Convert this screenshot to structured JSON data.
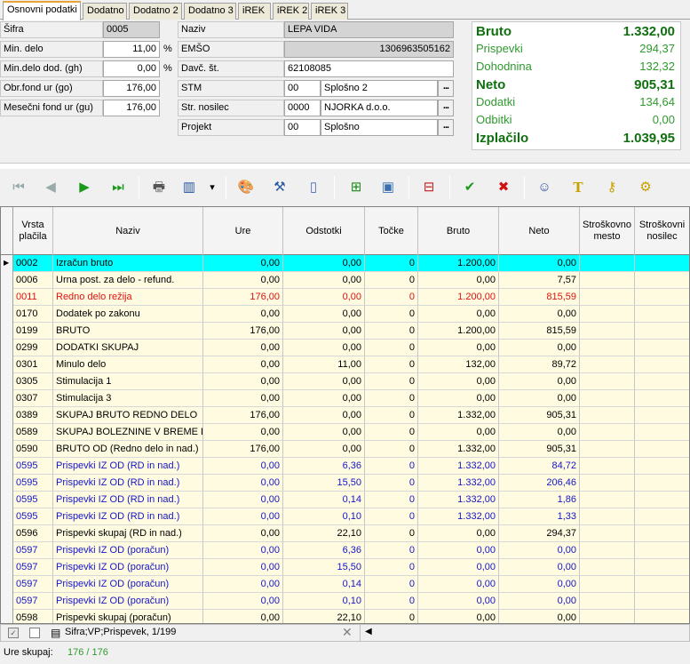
{
  "tabs": [
    "Osnovni podatki",
    "Dodatno",
    "Dodatno 2",
    "Dodatno 3",
    "iREK",
    "iREK 2",
    "iREK 3"
  ],
  "form": {
    "sifra_label": "Šifra",
    "sifra_value": "0005",
    "min_delo_label": "Min. delo",
    "min_delo_value": "11,00",
    "min_delo_dod_label": "Min.delo dod. (gh)",
    "min_delo_dod_value": "0,00",
    "obr_fond_label": "Obr.fond ur (go)",
    "obr_fond_value": "176,00",
    "mes_fond_label": "Mesečni fond ur (gu)",
    "mes_fond_value": "176,00",
    "percent": "%",
    "naziv_label": "Naziv",
    "naziv_value": "LEPA VIDA",
    "emso_label": "EMŠO",
    "emso_value": "1306963505162",
    "davc_label": "Davč. št.",
    "davc_value": "62108085",
    "stm_label": "STM",
    "stm_code": "00",
    "stm_value": "Splošno 2",
    "str_nos_label": "Str. nosilec",
    "str_nos_code": "0000",
    "str_nos_value": "NJORKA d.o.o.",
    "projekt_label": "Projekt",
    "projekt_code": "00",
    "projekt_value": "Splošno",
    "dots": "..."
  },
  "summary": [
    {
      "label": "Bruto",
      "value": "1.332,00",
      "bold": true
    },
    {
      "label": "Prispevki",
      "value": "294,37",
      "bold": false
    },
    {
      "label": "Dohodnina",
      "value": "132,32",
      "bold": false
    },
    {
      "label": "Neto",
      "value": "905,31",
      "bold": true
    },
    {
      "label": "Dodatki",
      "value": "134,64",
      "bold": false
    },
    {
      "label": "Odbitki",
      "value": "0,00",
      "bold": false
    },
    {
      "label": "Izplačilo",
      "value": "1.039,95",
      "bold": true
    }
  ],
  "colors": {
    "summary_green": "#2e9a2e",
    "summary_bold": "#107010",
    "row_red": "#e01010",
    "row_blue": "#1515c8",
    "selected": "#00ffff",
    "grid_bg": "#fffbe1"
  },
  "toolbar": [
    "first-icon",
    "prev-icon",
    "next-icon",
    "last-icon",
    "print-icon",
    "columns-icon",
    "dropdown-icon",
    "palette-icon",
    "tools-icon",
    "document-icon",
    "add-row-icon",
    "image-icon",
    "delete-row-icon",
    "confirm-icon",
    "cancel-icon",
    "person-icon",
    "filter-icon",
    "key-icon",
    "settings-icon"
  ],
  "grid": {
    "headers": [
      "Vrsta plačila",
      "Naziv",
      "Ure",
      "Odstotki",
      "Točke",
      "Bruto",
      "Neto",
      "Stroškovno mesto",
      "Stroškovni nosilec"
    ],
    "rows": [
      {
        "c": [
          "0002",
          "Izračun bruto",
          "0,00",
          "0,00",
          "0",
          "1.200,00",
          "0,00"
        ],
        "color": "black",
        "sel": true
      },
      {
        "c": [
          "0006",
          "Urna post. za delo - refund.",
          "0,00",
          "0,00",
          "0",
          "0,00",
          "7,57"
        ],
        "color": "black"
      },
      {
        "c": [
          "0011",
          "Redno delo režija",
          "176,00",
          "0,00",
          "0",
          "1.200,00",
          "815,59"
        ],
        "color": "red"
      },
      {
        "c": [
          "0170",
          "Dodatek po zakonu",
          "0,00",
          "0,00",
          "0",
          "0,00",
          "0,00"
        ],
        "color": "black"
      },
      {
        "c": [
          "0199",
          "BRUTO",
          "176,00",
          "0,00",
          "0",
          "1.200,00",
          "815,59"
        ],
        "color": "black"
      },
      {
        "c": [
          "0299",
          "DODATKI SKUPAJ",
          "0,00",
          "0,00",
          "0",
          "0,00",
          "0,00"
        ],
        "color": "black"
      },
      {
        "c": [
          "0301",
          "Minulo delo",
          "0,00",
          "11,00",
          "0",
          "132,00",
          "89,72"
        ],
        "color": "black"
      },
      {
        "c": [
          "0305",
          "Stimulacija 1",
          "0,00",
          "0,00",
          "0",
          "0,00",
          "0,00"
        ],
        "color": "black"
      },
      {
        "c": [
          "0307",
          "Stimulacija 3",
          "0,00",
          "0,00",
          "0",
          "0,00",
          "0,00"
        ],
        "color": "black"
      },
      {
        "c": [
          "0389",
          "SKUPAJ BRUTO REDNO DELO",
          "176,00",
          "0,00",
          "0",
          "1.332,00",
          "905,31"
        ],
        "color": "black"
      },
      {
        "c": [
          "0589",
          "SKUPAJ BOLEZNINE V BREME DO",
          "0,00",
          "0,00",
          "0",
          "0,00",
          "0,00"
        ],
        "color": "black"
      },
      {
        "c": [
          "0590",
          "BRUTO OD (Redno delo in nad.)",
          "176,00",
          "0,00",
          "0",
          "1.332,00",
          "905,31"
        ],
        "color": "black"
      },
      {
        "c": [
          "0595",
          "Prispevki IZ OD (RD in nad.)",
          "0,00",
          "6,36",
          "0",
          "1.332,00",
          "84,72"
        ],
        "color": "blue"
      },
      {
        "c": [
          "0595",
          "Prispevki IZ OD (RD in nad.)",
          "0,00",
          "15,50",
          "0",
          "1.332,00",
          "206,46"
        ],
        "color": "blue"
      },
      {
        "c": [
          "0595",
          "Prispevki IZ OD (RD in nad.)",
          "0,00",
          "0,14",
          "0",
          "1.332,00",
          "1,86"
        ],
        "color": "blue"
      },
      {
        "c": [
          "0595",
          "Prispevki IZ OD (RD in nad.)",
          "0,00",
          "0,10",
          "0",
          "1.332,00",
          "1,33"
        ],
        "color": "blue"
      },
      {
        "c": [
          "0596",
          "Prispevki skupaj (RD in nad.)",
          "0,00",
          "22,10",
          "0",
          "0,00",
          "294,37"
        ],
        "color": "black"
      },
      {
        "c": [
          "0597",
          "Prispevki IZ OD (poračun)",
          "0,00",
          "6,36",
          "0",
          "0,00",
          "0,00"
        ],
        "color": "blue"
      },
      {
        "c": [
          "0597",
          "Prispevki IZ OD (poračun)",
          "0,00",
          "15,50",
          "0",
          "0,00",
          "0,00"
        ],
        "color": "blue"
      },
      {
        "c": [
          "0597",
          "Prispevki IZ OD (poračun)",
          "0,00",
          "0,14",
          "0",
          "0,00",
          "0,00"
        ],
        "color": "blue"
      },
      {
        "c": [
          "0597",
          "Prispevki IZ OD (poračun)",
          "0,00",
          "0,10",
          "0",
          "0,00",
          "0,00"
        ],
        "color": "blue"
      },
      {
        "c": [
          "0598",
          "Prispevki skupaj (poračun)",
          "0,00",
          "22,10",
          "0",
          "0,00",
          "0,00"
        ],
        "color": "black"
      }
    ]
  },
  "footer": {
    "filter_text": "Sifra;VP;Prispevek, 1/199",
    "close": "✕"
  },
  "status": {
    "label": "Ure skupaj:",
    "value": "176 / 176"
  }
}
